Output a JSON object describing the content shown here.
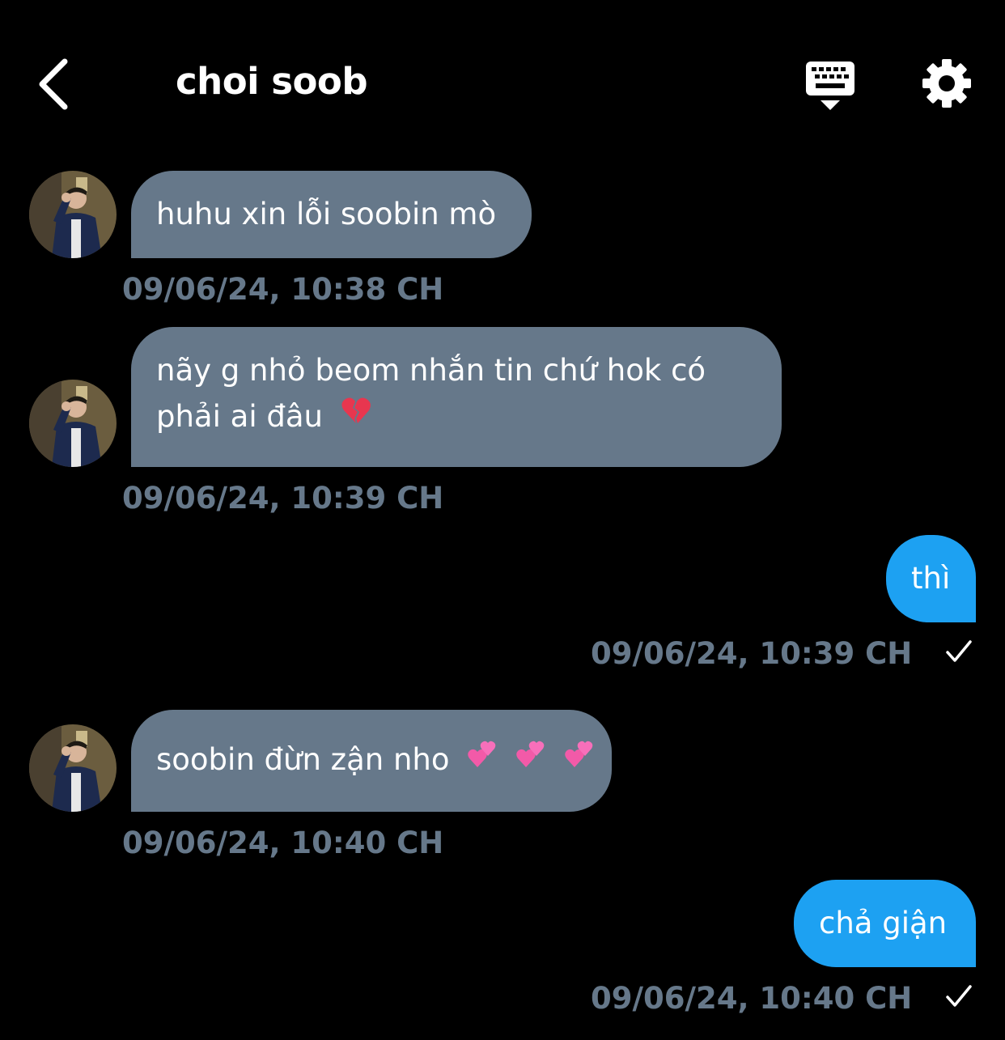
{
  "header": {
    "title": "choi soob",
    "icons": {
      "back": "chevron-left-icon",
      "keyboard": "keyboard-icon",
      "settings": "gear-icon"
    }
  },
  "colors": {
    "background": "#000000",
    "incoming_bubble": "#66788a",
    "outgoing_bubble": "#1da1f2",
    "timestamp": "#66788a",
    "text": "#ffffff"
  },
  "messages": [
    {
      "direction": "incoming",
      "line1": "huhu xin lỗi soobin mò",
      "timestamp": "09/06/24, 10:38 CH"
    },
    {
      "direction": "incoming",
      "line1": "nãy g nhỏ beom nhắn tin chứ hok có",
      "line2": "phải ai đâu",
      "emoji": "broken-heart-icon",
      "timestamp": "09/06/24, 10:39 CH"
    },
    {
      "direction": "outgoing",
      "line1": "thì",
      "timestamp": "09/06/24, 10:39 CH",
      "status": "check-icon"
    },
    {
      "direction": "incoming",
      "line1": "soobin đừn zận nho",
      "emoji": "two-hearts-icon",
      "emoji_count": 3,
      "timestamp": "09/06/24, 10:40 CH"
    },
    {
      "direction": "outgoing",
      "line1": "chả giận",
      "timestamp": "09/06/24, 10:40 CH",
      "status": "check-icon"
    }
  ]
}
